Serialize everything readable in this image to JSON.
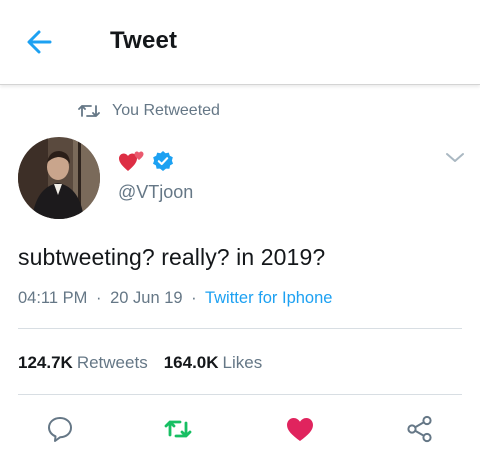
{
  "header": {
    "title": "Tweet",
    "back_icon": "arrow-left-icon"
  },
  "retweet_context": {
    "label": "You Retweeted",
    "icon": "retweet-icon"
  },
  "author": {
    "display_name_emoji": "two-hearts-icon",
    "verified": true,
    "handle": "@VTjoon"
  },
  "tweet": {
    "text": "subtweeting? really? in 2019?",
    "time": "04:11 PM",
    "date": "20 Jun 19",
    "source": "Twitter for Iphone",
    "separator": "·"
  },
  "stats": {
    "retweets_count": "124.7K",
    "retweets_label": "Retweets",
    "likes_count": "164.0K",
    "likes_label": "Likes"
  },
  "actions": {
    "reply_icon": "reply-icon",
    "retweet_icon": "retweet-icon",
    "like_icon": "heart-icon",
    "share_icon": "share-icon",
    "retweeted": true,
    "liked": true
  },
  "colors": {
    "accent": "#1da1f2",
    "retweet_green": "#17bf63",
    "like_red": "#e0245e",
    "muted": "#657786"
  }
}
